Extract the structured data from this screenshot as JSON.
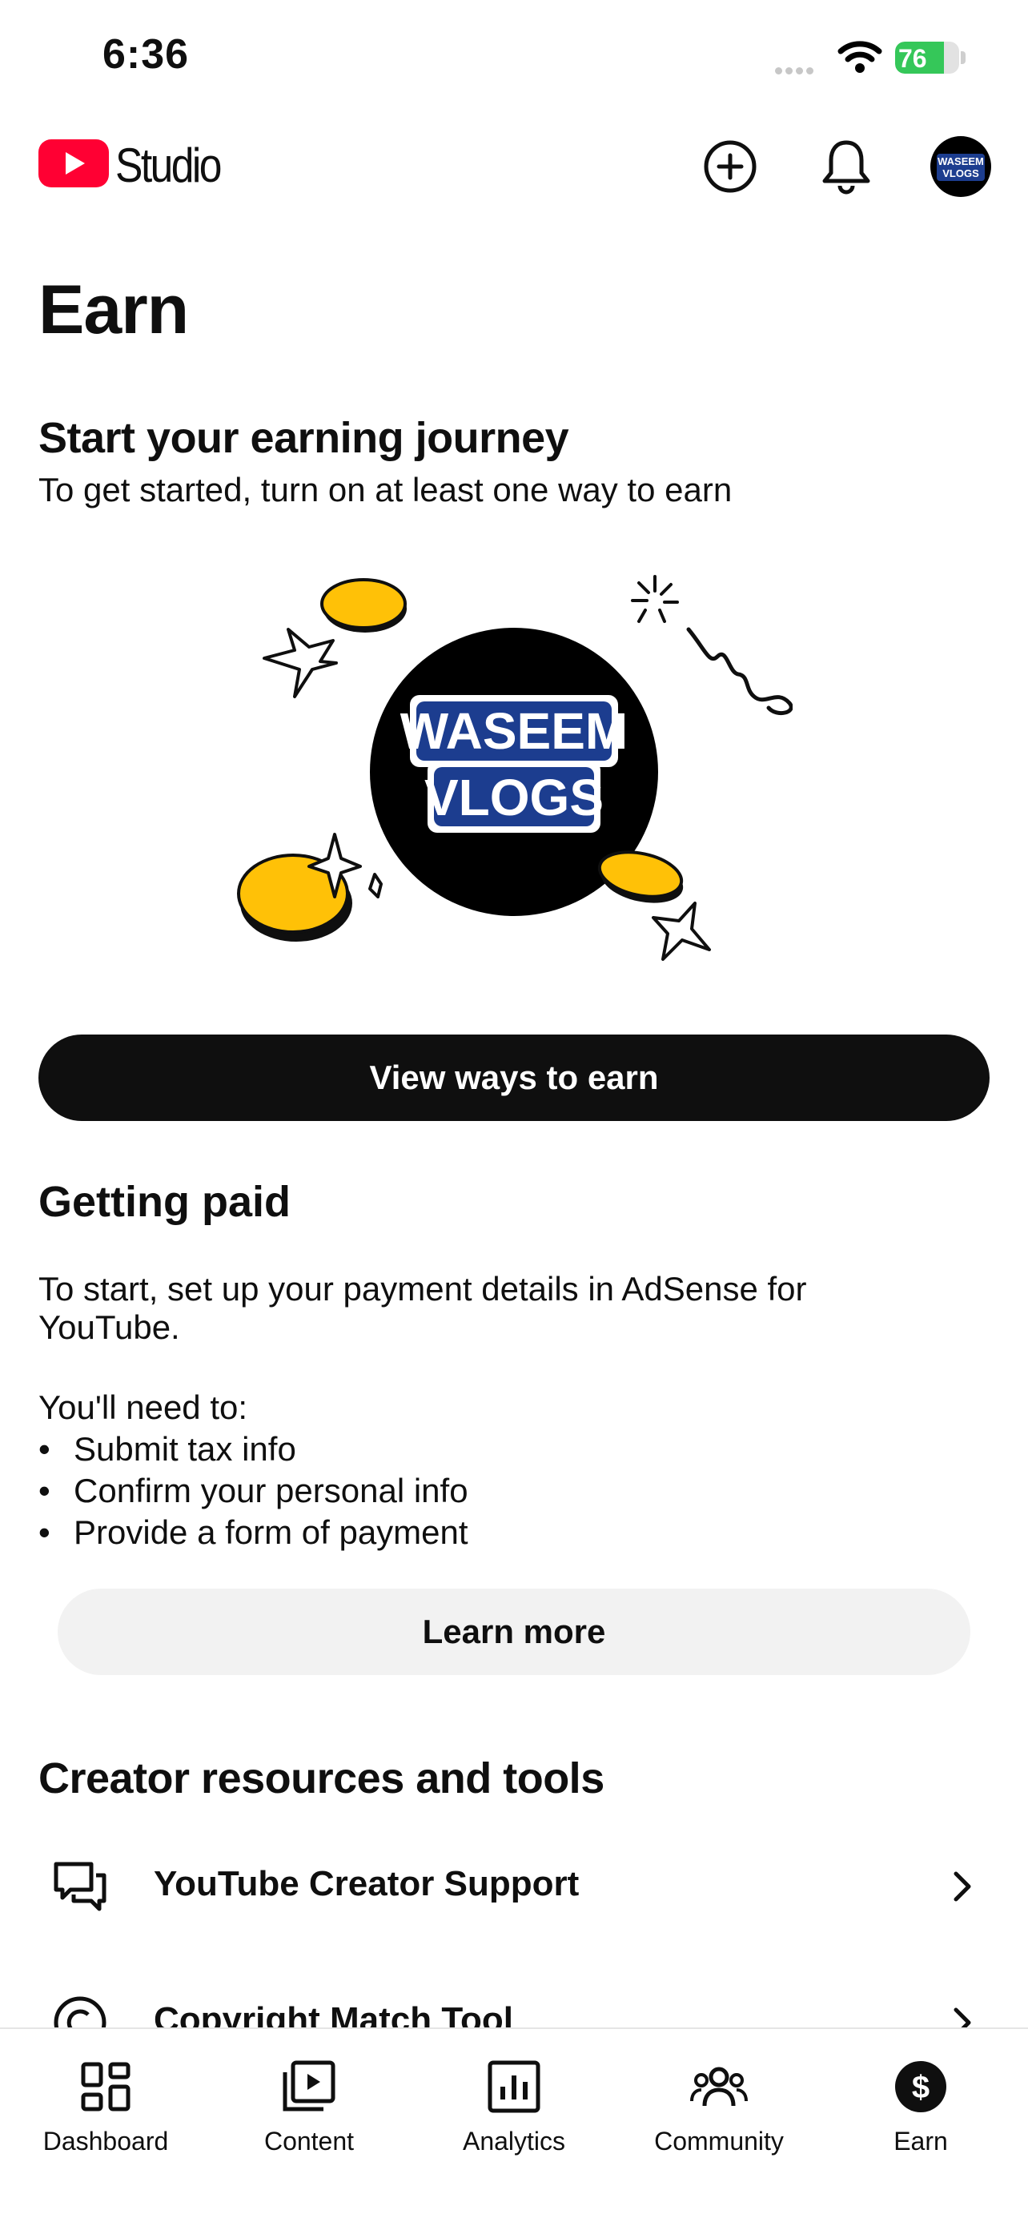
{
  "status_bar": {
    "time": "6:36",
    "battery": "76",
    "battery_level": 0.76
  },
  "header": {
    "logo_text": "Studio",
    "avatar_text": [
      "WASEEM",
      "VLOGS"
    ]
  },
  "page": {
    "title": "Earn"
  },
  "journey": {
    "title": "Start your earning journey",
    "subtitle": "To get started, turn on at least one way to earn",
    "badge_lines": [
      "WASEEM",
      "VLOGS"
    ],
    "button_label": "View ways to earn"
  },
  "getting_paid": {
    "title": "Getting paid",
    "description": "To start, set up your payment details in AdSense for YouTube.",
    "need_title": "You'll need to:",
    "requirements": [
      "Submit tax info",
      "Confirm your personal info",
      "Provide a form of payment"
    ],
    "button_label": "Learn more"
  },
  "resources": {
    "title": "Creator resources and tools",
    "items": [
      {
        "label": "YouTube Creator Support",
        "icon": "chat-bubbles-icon"
      },
      {
        "label": "Copyright Match Tool",
        "icon": "copyright-icon"
      }
    ]
  },
  "bottom_nav": {
    "items": [
      {
        "label": "Dashboard",
        "icon": "dashboard-icon"
      },
      {
        "label": "Content",
        "icon": "content-icon"
      },
      {
        "label": "Analytics",
        "icon": "analytics-icon"
      },
      {
        "label": "Community",
        "icon": "community-icon"
      },
      {
        "label": "Earn",
        "icon": "earn-icon",
        "active": true
      }
    ]
  },
  "colors": {
    "brand_red": "#ff0033",
    "coin_yellow": "#ffc107",
    "ink": "#0f0f0f",
    "battery_green": "#35c759"
  }
}
